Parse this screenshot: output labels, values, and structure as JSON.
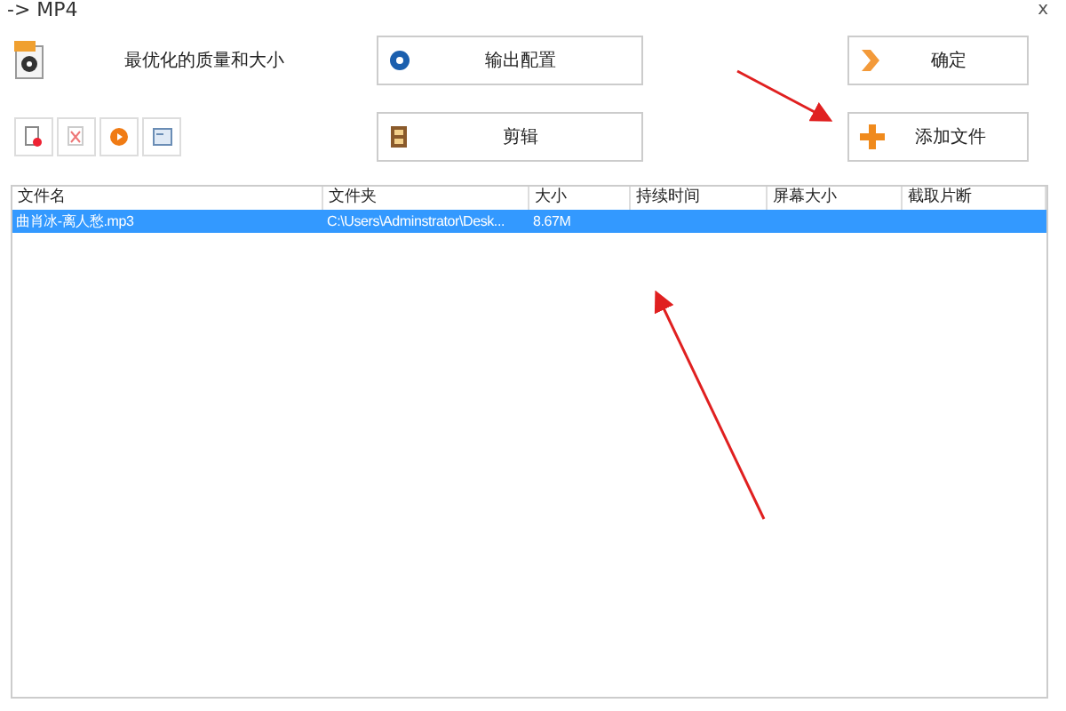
{
  "window": {
    "title": "-> MP4",
    "close": "x"
  },
  "profile": {
    "label": "最优化的质量和大小"
  },
  "buttons": [
    {
      "label": "输出配置",
      "kind": "config"
    },
    {
      "label": "剪辑",
      "kind": "clip"
    },
    {
      "label": "确定",
      "kind": "ok"
    },
    {
      "label": "添加文件",
      "kind": "add"
    }
  ],
  "tools": [
    {
      "kind": "remove"
    },
    {
      "kind": "clear"
    },
    {
      "kind": "play"
    },
    {
      "kind": "info"
    }
  ],
  "table": {
    "columns": [
      "文件名",
      "文件夹",
      "大小",
      "持续时间",
      "屏幕大小",
      "截取片断"
    ],
    "rows": [
      {
        "selected": true,
        "cells": [
          "曲肖冰-离人愁.mp3",
          "C:\\Users\\Adminstrator\\Desk...",
          "8.67M",
          "",
          "",
          ""
        ]
      }
    ]
  }
}
